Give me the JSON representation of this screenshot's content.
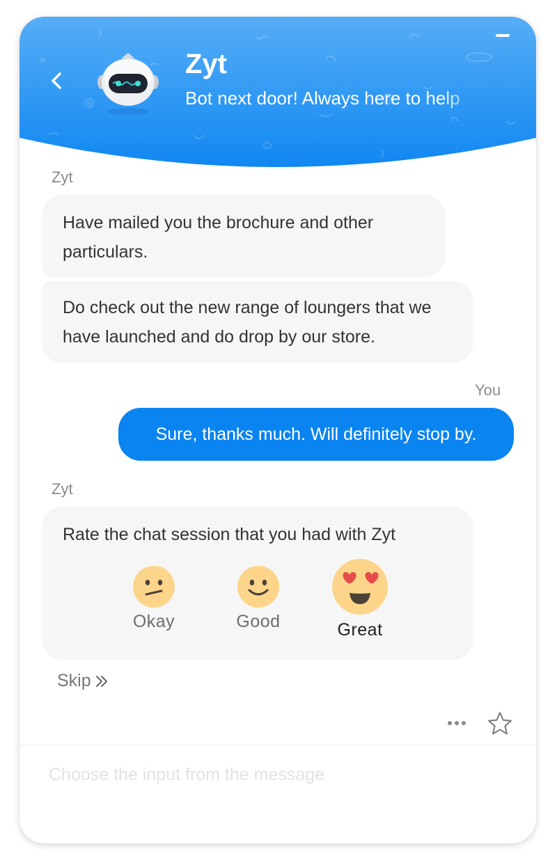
{
  "header": {
    "bot_name": "Zyt",
    "tagline": "Bot next door! Always here to help",
    "colors": {
      "gradient_top": "#56aef6",
      "gradient_bottom": "#1087f2"
    },
    "icons": {
      "back": "chevron-left-icon",
      "minimize": "minimize-icon",
      "avatar": "robot-avatar-icon"
    }
  },
  "messages": [
    {
      "sender": "Zyt",
      "bubbles": [
        "Have mailed you the brochure and other particulars.",
        "Do check out the new range of loungers that we have launched and do drop by our store."
      ]
    },
    {
      "sender": "You",
      "bubbles": [
        "Sure, thanks much. Will definitely stop by."
      ]
    },
    {
      "sender": "Zyt",
      "bubbles": [
        "Rate the chat session that you had with Zyt"
      ]
    }
  ],
  "rating": {
    "options": [
      {
        "label": "Okay",
        "icon": "neutral-face-icon"
      },
      {
        "label": "Good",
        "icon": "smiling-face-icon"
      },
      {
        "label": "Great",
        "icon": "heart-eyes-face-icon"
      }
    ],
    "selected": "Great"
  },
  "skip_label": "Skip",
  "toolbar": {
    "more_icon": "more-dots-icon",
    "favorite_icon": "star-icon"
  },
  "input": {
    "placeholder": "Choose the input from the message",
    "value": ""
  },
  "colors": {
    "user_bubble": "#0a84f0",
    "bot_bubble": "#f6f6f6",
    "emoji_face": "#fcd58a"
  }
}
